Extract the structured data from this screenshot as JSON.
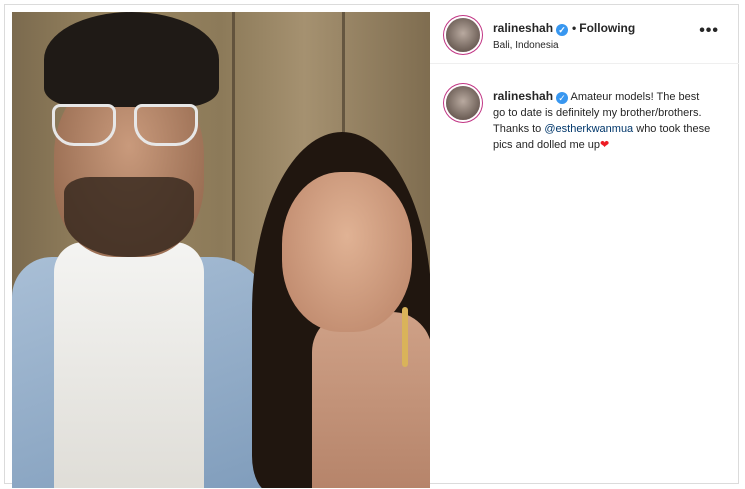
{
  "post": {
    "username": "ralineshah",
    "following_label": "Following",
    "separator": "•",
    "location": "Bali, Indonesia",
    "more_label": "•••"
  },
  "caption": {
    "username": "ralineshah",
    "text_before_mention": " Amateur models! The best go to date is definitely my brother/brothers. Thanks to ",
    "mention": "@estherkwanmua",
    "text_after_mention": " who took these pics and dolled me up",
    "heart": "❤"
  },
  "icons": {
    "verified": "✓"
  },
  "colors": {
    "verified_badge": "#3897f0",
    "mention": "#00376b",
    "heart": "#ed1c24",
    "avatar_ring": "#c13584"
  }
}
